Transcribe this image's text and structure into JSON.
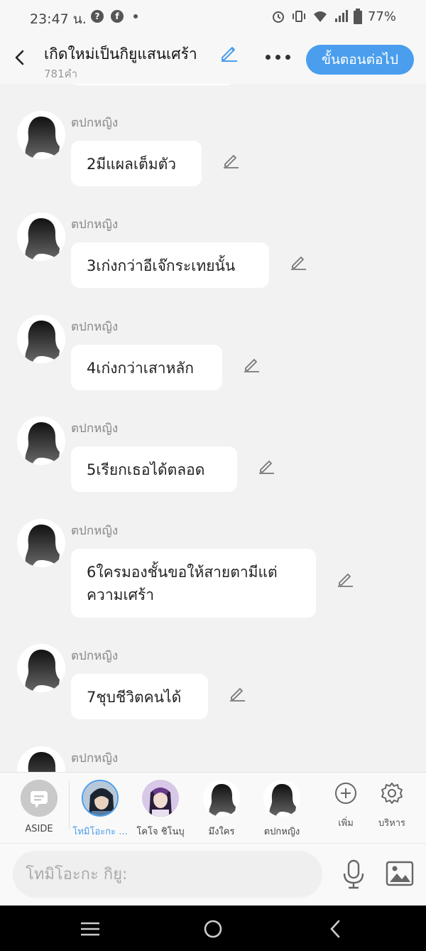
{
  "status": {
    "time": "23:47 น.",
    "battery": "77%"
  },
  "header": {
    "title": "เกิดใหม่เป็นกิยูแสนเศร้า",
    "word_count": "781คำ",
    "next_label": "ขั้นตอนต่อไป"
  },
  "messages": [
    {
      "sender": "ตปกหญิง",
      "text": "2มีแผลเต็มตัว"
    },
    {
      "sender": "ตปกหญิง",
      "text": "3เก่งกว่าอีเจ๊กระเทยนั้น"
    },
    {
      "sender": "ตปกหญิง",
      "text": "4เก่งกว่าเสาหลัก"
    },
    {
      "sender": "ตปกหญิง",
      "text": "5เรียกเธอได้ตลอด"
    },
    {
      "sender": "ตปกหญิง",
      "text": "6ใครมองชั้นขอให้สายตามีแต่\nความเศร้า"
    },
    {
      "sender": "ตปกหญิง",
      "text": "7ชุบชีวิตคนได้"
    },
    {
      "sender": "ตปกหญิง",
      "text": ""
    }
  ],
  "characters": [
    {
      "name": "ASIDE"
    },
    {
      "name": "โทมิโอะกะ ..."
    },
    {
      "name": "โคโจ ชิโนบุ"
    },
    {
      "name": "มึงใคร"
    },
    {
      "name": "ตปกหญิง"
    }
  ],
  "tools": {
    "add_label": "เพิ่ม",
    "manage_label": "บริหาร"
  },
  "input": {
    "placeholder": "โทมิโอะกะ กิยู:"
  },
  "colors": {
    "accent": "#4a9eed"
  }
}
